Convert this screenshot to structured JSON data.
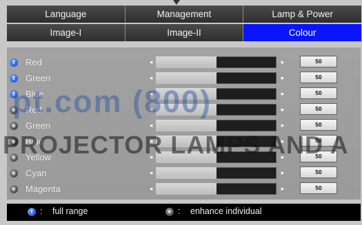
{
  "tabs_row1": [
    {
      "label": "Language",
      "active": false
    },
    {
      "label": "Management",
      "active": false
    },
    {
      "label": "Lamp & Power",
      "active": false
    }
  ],
  "tabs_row2": [
    {
      "label": "Image-I",
      "active": false
    },
    {
      "label": "Image-II",
      "active": false
    },
    {
      "label": "Colour",
      "active": true
    }
  ],
  "rows": [
    {
      "label": "Red",
      "mode": "full",
      "value": "50",
      "level": 0.5
    },
    {
      "label": "Green",
      "mode": "full",
      "value": "50",
      "level": 0.5
    },
    {
      "label": "Blue",
      "mode": "full",
      "value": "50",
      "level": 0.5
    },
    {
      "label": "Red",
      "mode": "enhance",
      "value": "50",
      "level": 0.5
    },
    {
      "label": "Green",
      "mode": "enhance",
      "value": "50",
      "level": 0.5
    },
    {
      "label": "Blue",
      "mode": "enhance",
      "value": "50",
      "level": 0.5
    },
    {
      "label": "Yellow",
      "mode": "enhance",
      "value": "50",
      "level": 0.5
    },
    {
      "label": "Cyan",
      "mode": "enhance",
      "value": "50",
      "level": 0.5
    },
    {
      "label": "Magenta",
      "mode": "enhance",
      "value": "50",
      "level": 0.5
    }
  ],
  "legend": {
    "full_label": "full range",
    "enhance_label": "enhance individual",
    "separator": ":"
  },
  "watermark": {
    "line1": "pt.com (800)",
    "line2": "PROJECTOR LAMPS AND A"
  },
  "colors": {
    "active_tab": "#0a14ff",
    "panel_bg": "#9e9e9e",
    "footer_bg": "#000000",
    "full_badge": "#1240c8",
    "enhance_badge": "#2a2a2a"
  }
}
